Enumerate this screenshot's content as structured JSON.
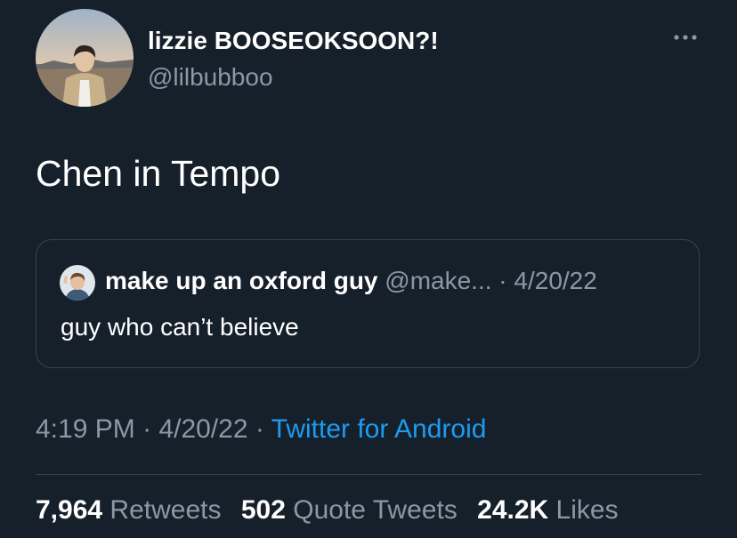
{
  "tweet": {
    "author": {
      "display_name": "lizzie BOOSEOKSOON?!",
      "handle": "@lilbubboo"
    },
    "text": "Chen in Tempo",
    "quoted": {
      "display_name": "make up an oxford guy",
      "handle": "@make...",
      "separator": "·",
      "date": "4/20/22",
      "text": "guy who can’t believe"
    },
    "meta": {
      "time": "4:19 PM",
      "sep1": "·",
      "date": "4/20/22",
      "sep2": "·",
      "source": "Twitter for Android"
    },
    "stats": {
      "retweets_count": "7,964",
      "retweets_label": "Retweets",
      "quotes_count": "502",
      "quotes_label": "Quote Tweets",
      "likes_count": "24.2K",
      "likes_label": "Likes"
    }
  },
  "icons": {
    "more": "more-horizontal-icon"
  },
  "colors": {
    "background": "#15202b",
    "primary_text": "#ffffff",
    "secondary_text": "#8b98a5",
    "link": "#1d9bf0",
    "border": "#38444d"
  }
}
